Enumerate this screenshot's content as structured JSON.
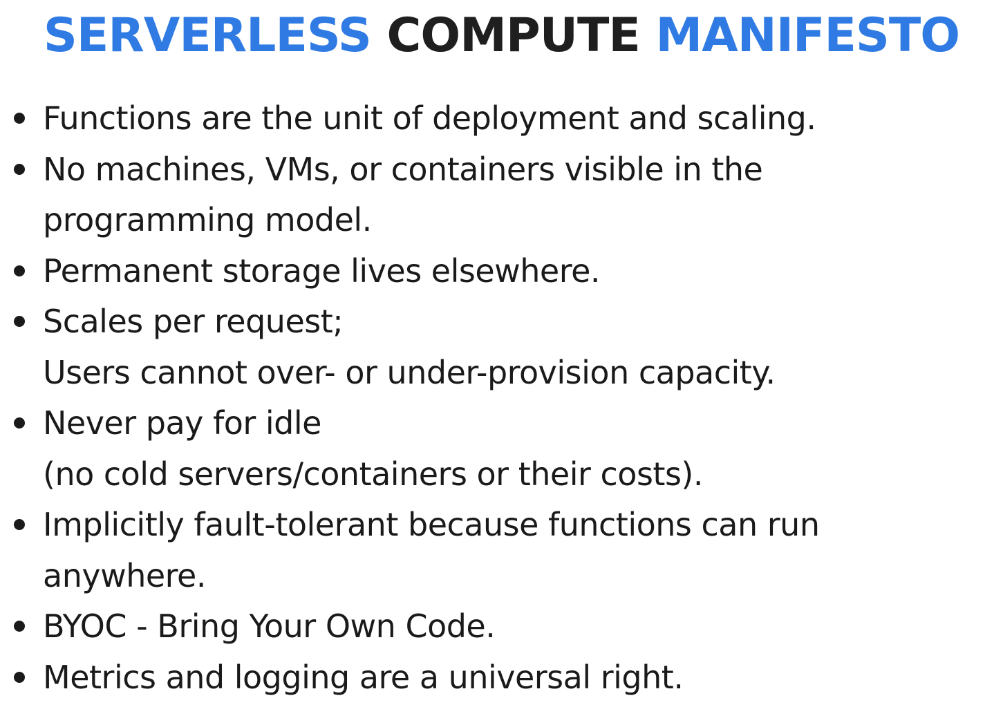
{
  "theme": {
    "accent": "#2f7be3",
    "text": "#1a1a1a"
  },
  "title": {
    "part1": "SERVERLESS",
    "part2": "COMPUTE",
    "part3": "MANIFESTO"
  },
  "bullets": [
    {
      "lines": [
        "Functions are the unit of deployment and scaling."
      ]
    },
    {
      "lines": [
        "No machines, VMs, or containers visible in the",
        "programming model."
      ]
    },
    {
      "lines": [
        "Permanent storage lives elsewhere."
      ]
    },
    {
      "lines": [
        "Scales per request;",
        "Users cannot over- or under-provision capacity."
      ]
    },
    {
      "lines": [
        "Never pay for idle",
        "(no cold servers/containers or their costs)."
      ]
    },
    {
      "lines": [
        "Implicitly fault-tolerant because functions can run",
        "anywhere."
      ]
    },
    {
      "lines": [
        "BYOC - Bring Your Own Code."
      ]
    },
    {
      "lines": [
        "Metrics and logging are a universal right."
      ]
    }
  ]
}
